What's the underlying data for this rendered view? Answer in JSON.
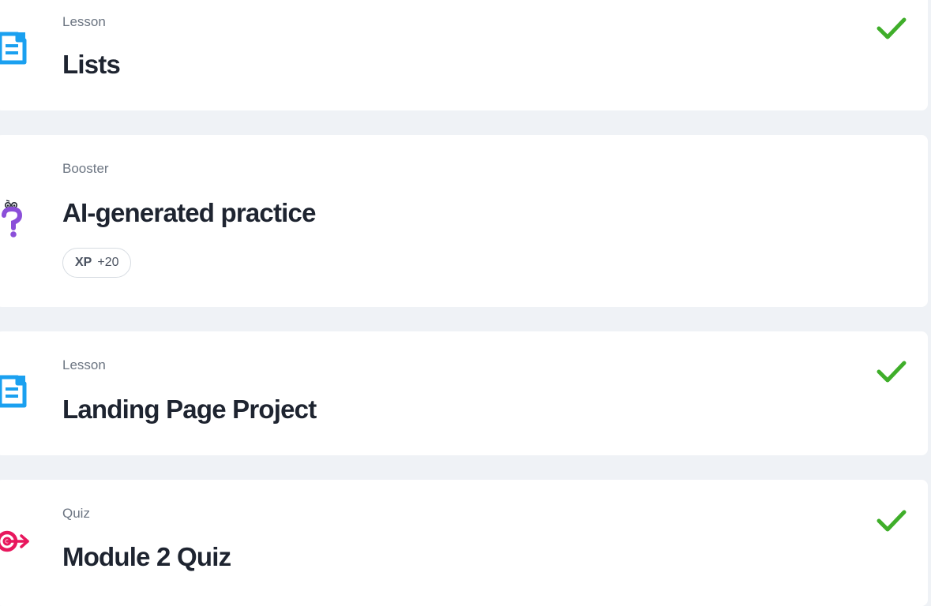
{
  "colors": {
    "page_background": "#eff2f6",
    "card_background": "#ffffff",
    "lesson_icon": "#1aa0f0",
    "booster_icon": "#8b4fd9",
    "quiz_icon": "#e8175d",
    "check": "#3fae2a"
  },
  "items": [
    {
      "type": "Lesson",
      "title": "Lists",
      "icon": "lesson-document-icon",
      "completed": true
    },
    {
      "type": "Booster",
      "title": "AI-generated practice",
      "icon": "question-mark-character-icon",
      "completed": false,
      "xp": {
        "label": "XP",
        "value": "+20"
      }
    },
    {
      "type": "Lesson",
      "title": "Landing Page Project",
      "icon": "lesson-document-icon",
      "completed": true
    },
    {
      "type": "Quiz",
      "title": "Module 2 Quiz",
      "icon": "target-icon",
      "completed": true
    }
  ]
}
